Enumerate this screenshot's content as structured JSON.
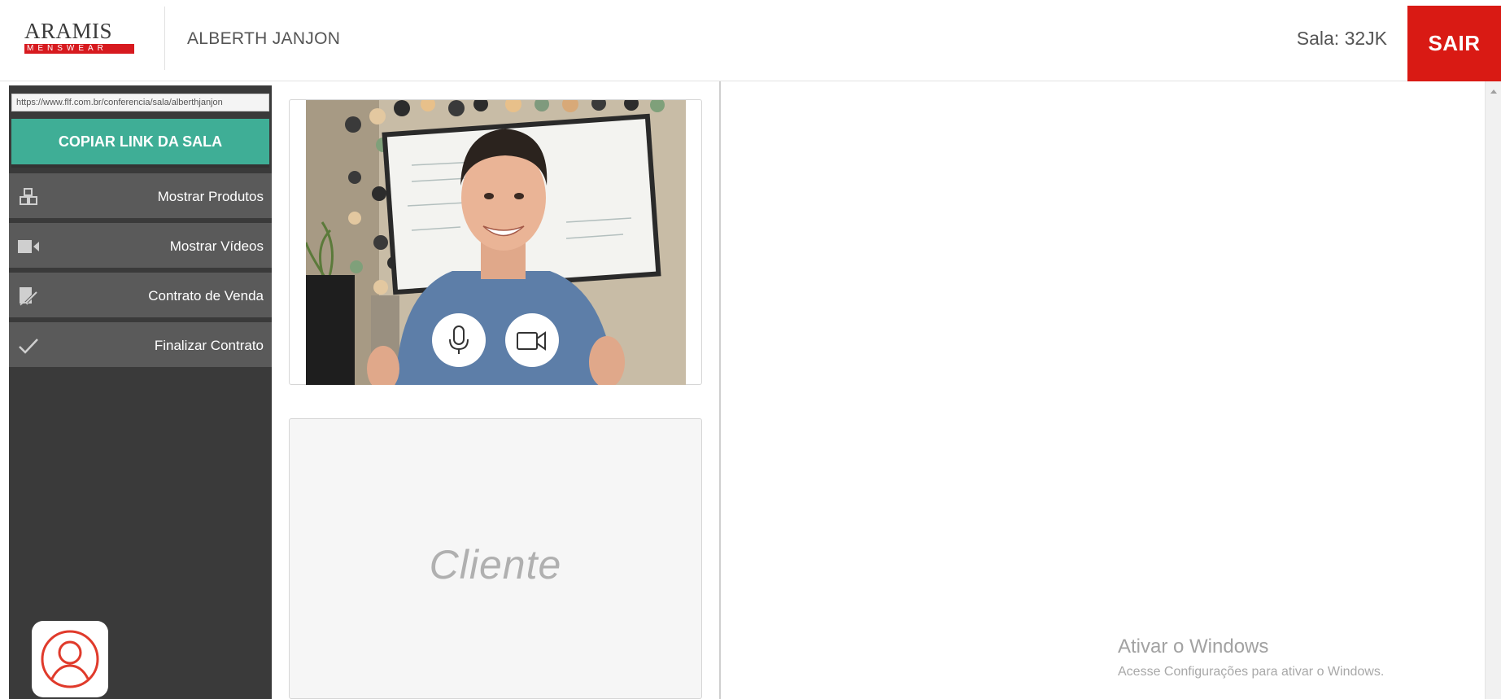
{
  "header": {
    "logo_name": "ARAMIS",
    "logo_sub": "MENSWEAR",
    "user_name": "ALBERTH JANJON",
    "room_label": "Sala: 32JK",
    "exit_label": "SAIR"
  },
  "sidebar": {
    "room_url": "https://www.flf.com.br/conferencia/sala/alberthjanjon",
    "copy_label": "COPIAR LINK DA SALA",
    "items": [
      {
        "label": "Mostrar Produtos",
        "icon": "boxes-icon"
      },
      {
        "label": "Mostrar Vídeos",
        "icon": "video-camera-icon"
      },
      {
        "label": "Contrato de Venda",
        "icon": "signature-document-icon"
      },
      {
        "label": "Finalizar Contrato",
        "icon": "check-icon"
      }
    ]
  },
  "client": {
    "label": "Cliente"
  },
  "watermark": {
    "title": "Ativar o Windows",
    "subtitle": "Acesse Configurações para ativar o Windows."
  },
  "colors": {
    "accent_green": "#3fae96",
    "exit_red": "#d91a14",
    "sidebar_dark": "#3a3a3a",
    "sidebar_item": "#5a5a5a"
  }
}
